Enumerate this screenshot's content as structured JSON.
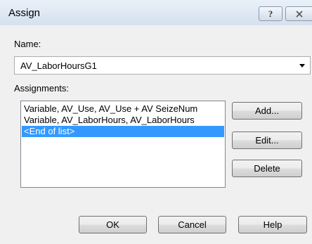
{
  "window": {
    "title": "Assign",
    "help_glyph": "?"
  },
  "name_field": {
    "label": "Name:",
    "value": "AV_LaborHoursG1"
  },
  "assignments": {
    "label": "Assignments:",
    "items": [
      "Variable, AV_Use, AV_Use + AV SeizeNum",
      "Variable, AV_LaborHours, AV_LaborHours",
      "<End of list>"
    ],
    "selected_index": 2
  },
  "side_buttons": {
    "add": "Add...",
    "edit": "Edit...",
    "delete": "Delete"
  },
  "bottom_buttons": {
    "ok": "OK",
    "cancel": "Cancel",
    "help": "Help"
  },
  "colors": {
    "selection": "#3399ff",
    "titlebar": "#dde7f3"
  },
  "icons": {
    "title_help": "help-icon",
    "title_close": "close-icon",
    "combo_arrow": "dropdown-arrow-icon"
  }
}
